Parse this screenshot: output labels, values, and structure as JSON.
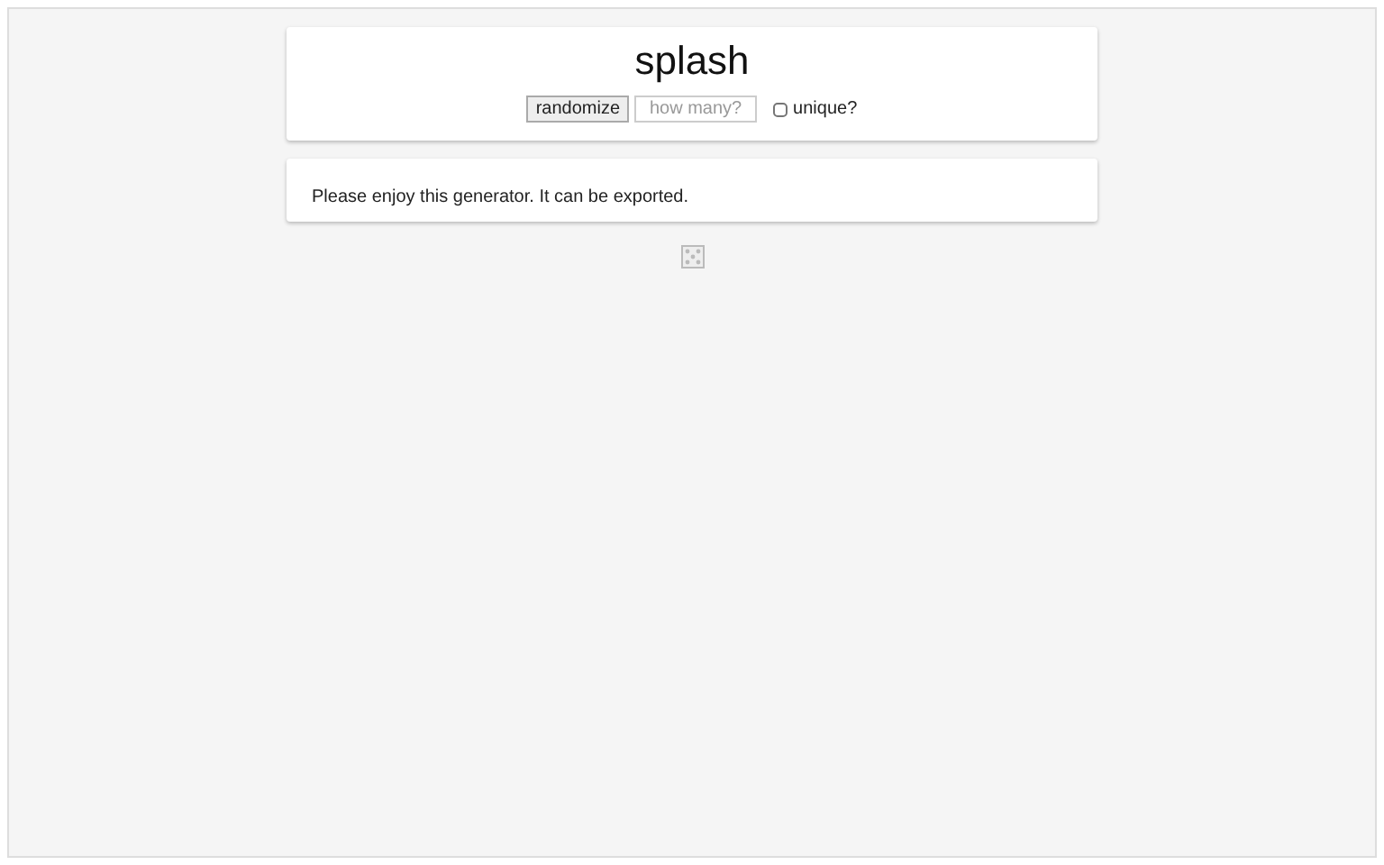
{
  "header": {
    "title": "splash",
    "button": "randomize",
    "count_field": {
      "placeholder": "how many?"
    },
    "unique": {
      "label": "unique?",
      "checked": false
    }
  },
  "output": {
    "text": "Please enjoy this generator. It can be exported."
  }
}
